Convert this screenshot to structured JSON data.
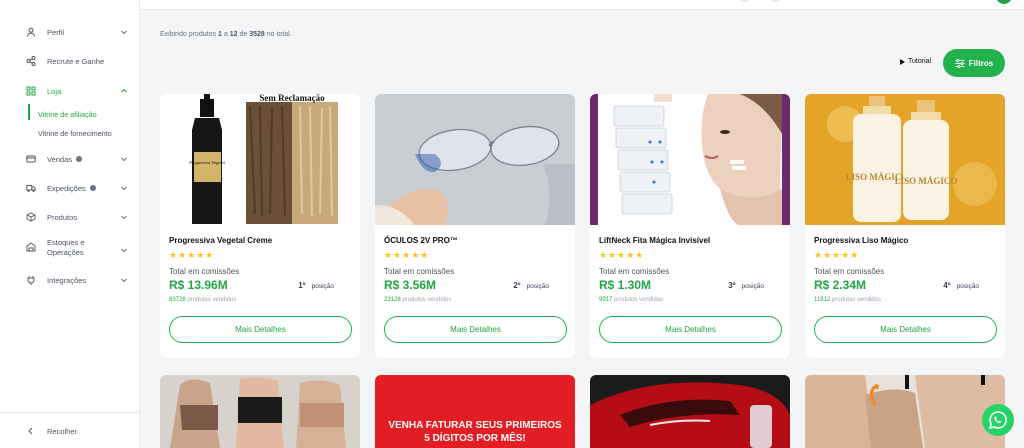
{
  "sidebar": {
    "items": [
      {
        "label": "Perfil"
      },
      {
        "label": "Recrute e Ganhe"
      },
      {
        "label": "Loja"
      },
      {
        "label": "Vendas"
      },
      {
        "label": "Expedições"
      },
      {
        "label": "Produtos"
      },
      {
        "label": "Estoques e"
      },
      {
        "label": "Integrações"
      }
    ],
    "estoques_line2": "Operações",
    "sub": [
      {
        "label": "Vitrine de afiliação"
      },
      {
        "label": "Vitrine de fornecimento"
      }
    ],
    "collapse_label": "Recolher"
  },
  "main": {
    "showing_prefix": "Exibindo produtos",
    "range_from": "1",
    "range_mid": "a",
    "range_to": "12",
    "range_de": "de",
    "total": "3528",
    "showing_suffix": "no total.",
    "tutorial_label": "Tutorial",
    "filters_label": "Filtros"
  },
  "cards": [
    {
      "name": "Progressiva Vegetal Creme",
      "stars": "★★★★★",
      "commission_label": "Total em comissões",
      "amount": "R$ 13.96M",
      "rank": "1º",
      "rank_label": "posição",
      "sold_count": "83728",
      "sold_label": "produtos vendidos",
      "button": "Mais Detalhes",
      "img_text_top": "Sem Reclamação",
      "img_text_bottle": "Progressiva Vegetal"
    },
    {
      "name": "ÓCULOS 2V PRO™",
      "stars": "★★★★★",
      "commission_label": "Total em comissões",
      "amount": "R$ 3.56M",
      "rank": "2º",
      "rank_label": "posição",
      "sold_count": "23128",
      "sold_label": "produtos vendidos",
      "button": "Mais Detalhes"
    },
    {
      "name": "LiftNeck Fita Mágica Invisível",
      "stars": "★★★★★",
      "commission_label": "Total em comissões",
      "amount": "R$ 1.30M",
      "rank": "3º",
      "rank_label": "posição",
      "sold_count": "9917",
      "sold_label": "produtos vendidos",
      "button": "Mais Detalhes"
    },
    {
      "name": "Progressiva Liso Mágico",
      "stars": "★★★★★",
      "commission_label": "Total em comissões",
      "amount": "R$ 2.34M",
      "rank": "4º",
      "rank_label": "posição",
      "sold_count": "11812",
      "sold_label": "produtos vendidos",
      "button": "Mais Detalhes",
      "img_text_bottle1": "LISO MÁGICO",
      "img_text_bottle2": "LISO MÁGICO"
    }
  ],
  "promo": {
    "line1": "VENHA FATURAR SEUS PRIMEIROS",
    "line2": "5 DÍGITOS POR MÊS!"
  },
  "colors": {
    "accent": "#22a447",
    "button_green": "#22b14c",
    "star": "#fbbf24",
    "whatsapp": "#25d366"
  }
}
